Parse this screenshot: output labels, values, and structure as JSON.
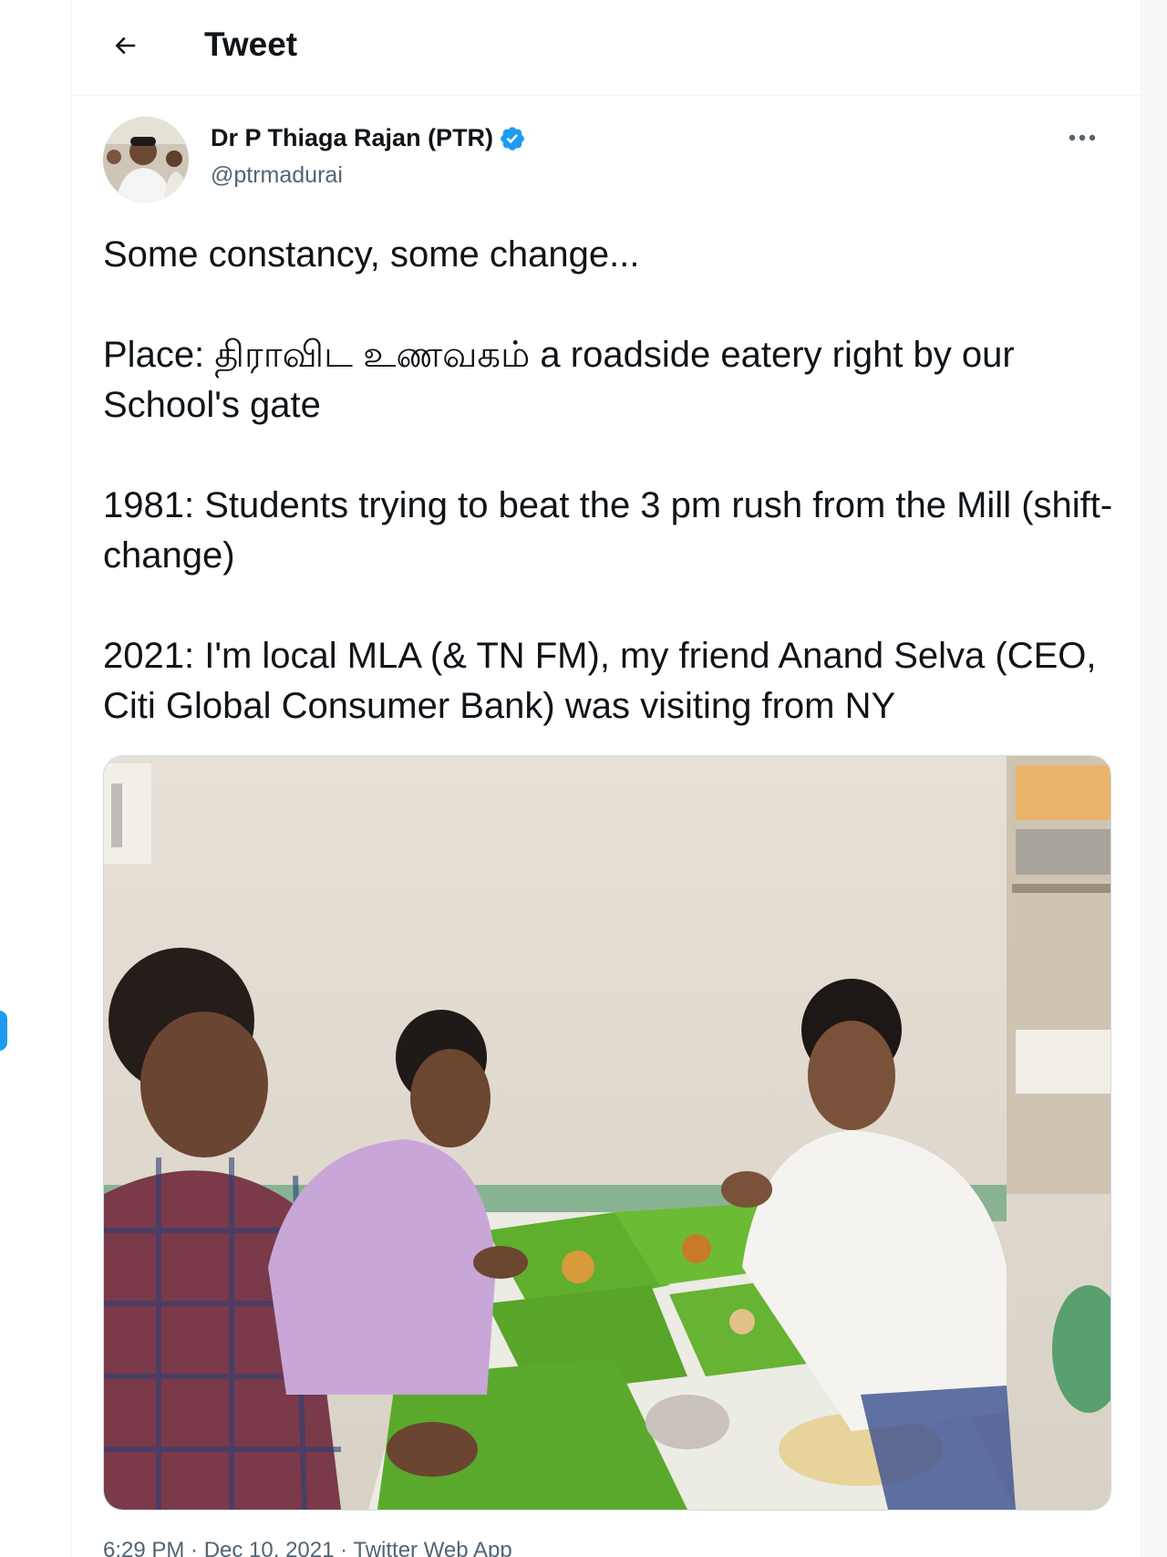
{
  "header": {
    "back_icon": "arrow-left-icon",
    "title": "Tweet"
  },
  "author": {
    "display_name": "Dr P Thiaga Rajan (PTR)",
    "handle": "@ptrmadurai",
    "verified_icon": "verified-badge-icon",
    "verified_color": "#1d9bf0",
    "more_icon": "more-horizontal-icon"
  },
  "tweet": {
    "paragraphs": [
      "Some constancy, some change...",
      "Place: திராவிட உணவகம் a roadside eatery right by our School's gate",
      "1981: Students trying to beat the 3 pm rush from the Mill (shift-change)",
      "2021: I'm local MLA (& TN FM), my friend Anand Selva (CEO, Citi Global Consumer Bank) was visiting from NY"
    ],
    "timestamp": "6:29 PM · Dec 10, 2021 · Twitter Web App"
  },
  "colors": {
    "text_primary": "#0f1419",
    "text_secondary": "#536471",
    "accent": "#1d9bf0",
    "border": "#eff3f4"
  }
}
